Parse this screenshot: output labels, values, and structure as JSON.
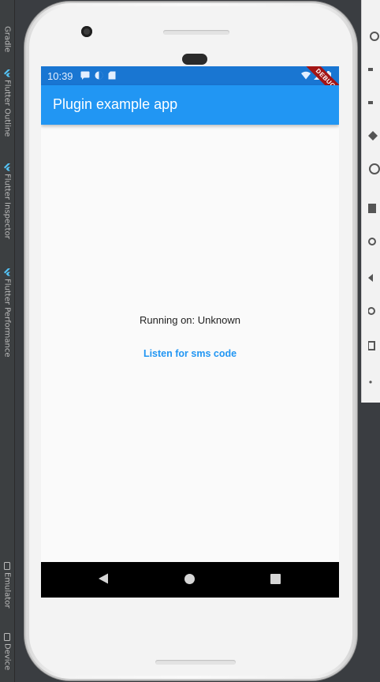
{
  "ide_tabs": [
    {
      "label": "Gradle"
    },
    {
      "label": "Flutter Outline"
    },
    {
      "label": "Flutter Inspector"
    },
    {
      "label": "Flutter Performance"
    },
    {
      "label": "Emulator"
    },
    {
      "label": "Device"
    }
  ],
  "status_bar": {
    "time": "10:39",
    "debug_label": "DEBUG"
  },
  "app_bar": {
    "title": "Plugin example app"
  },
  "body": {
    "running_text": "Running on: Unknown",
    "listen_button_label": "Listen for sms code"
  },
  "colors": {
    "app_bar": "#2196f3",
    "status_bar": "#1976d2",
    "accent": "#2196f3",
    "nav_bar": "#000000"
  },
  "icons": {
    "status_left": [
      "sms-icon",
      "sim-icon",
      "sd-card-icon",
      "battery-saver-icon"
    ],
    "status_right": [
      "wifi-icon",
      "signal-icon",
      "battery-icon"
    ],
    "navigation": [
      "back-icon",
      "home-icon",
      "recents-icon"
    ]
  }
}
